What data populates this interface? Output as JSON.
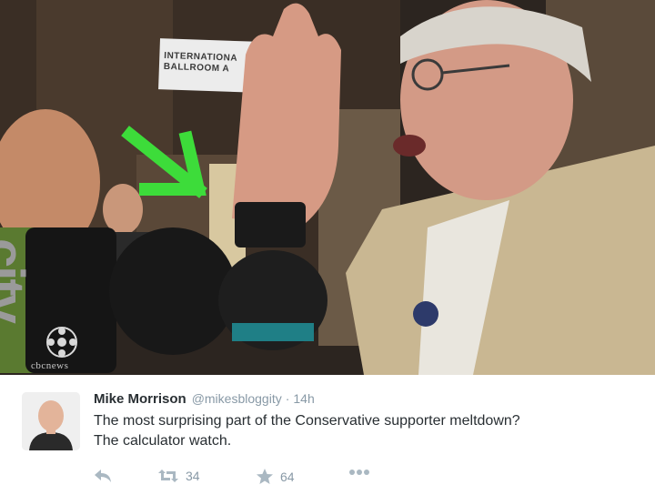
{
  "photo": {
    "sign_lines": [
      "INTERNATIONA",
      "BALLROOM A"
    ],
    "mic_brand": "citv",
    "network_logo_text": "cbcnews",
    "arrow_color": "#3ddc3a"
  },
  "tweet": {
    "author_name": "Mike Morrison",
    "author_handle": "@mikesbloggity",
    "separator": "·",
    "timestamp": "14h",
    "text_line_1": "The most surprising part of the Conservative supporter meltdown?",
    "text_line_2": "The calculator watch.",
    "actions": {
      "reply_icon": "reply-icon",
      "retweet_icon": "retweet-icon",
      "retweet_count": "34",
      "like_icon": "star-icon",
      "like_count": "64",
      "more_icon": "more-dots-icon"
    }
  }
}
